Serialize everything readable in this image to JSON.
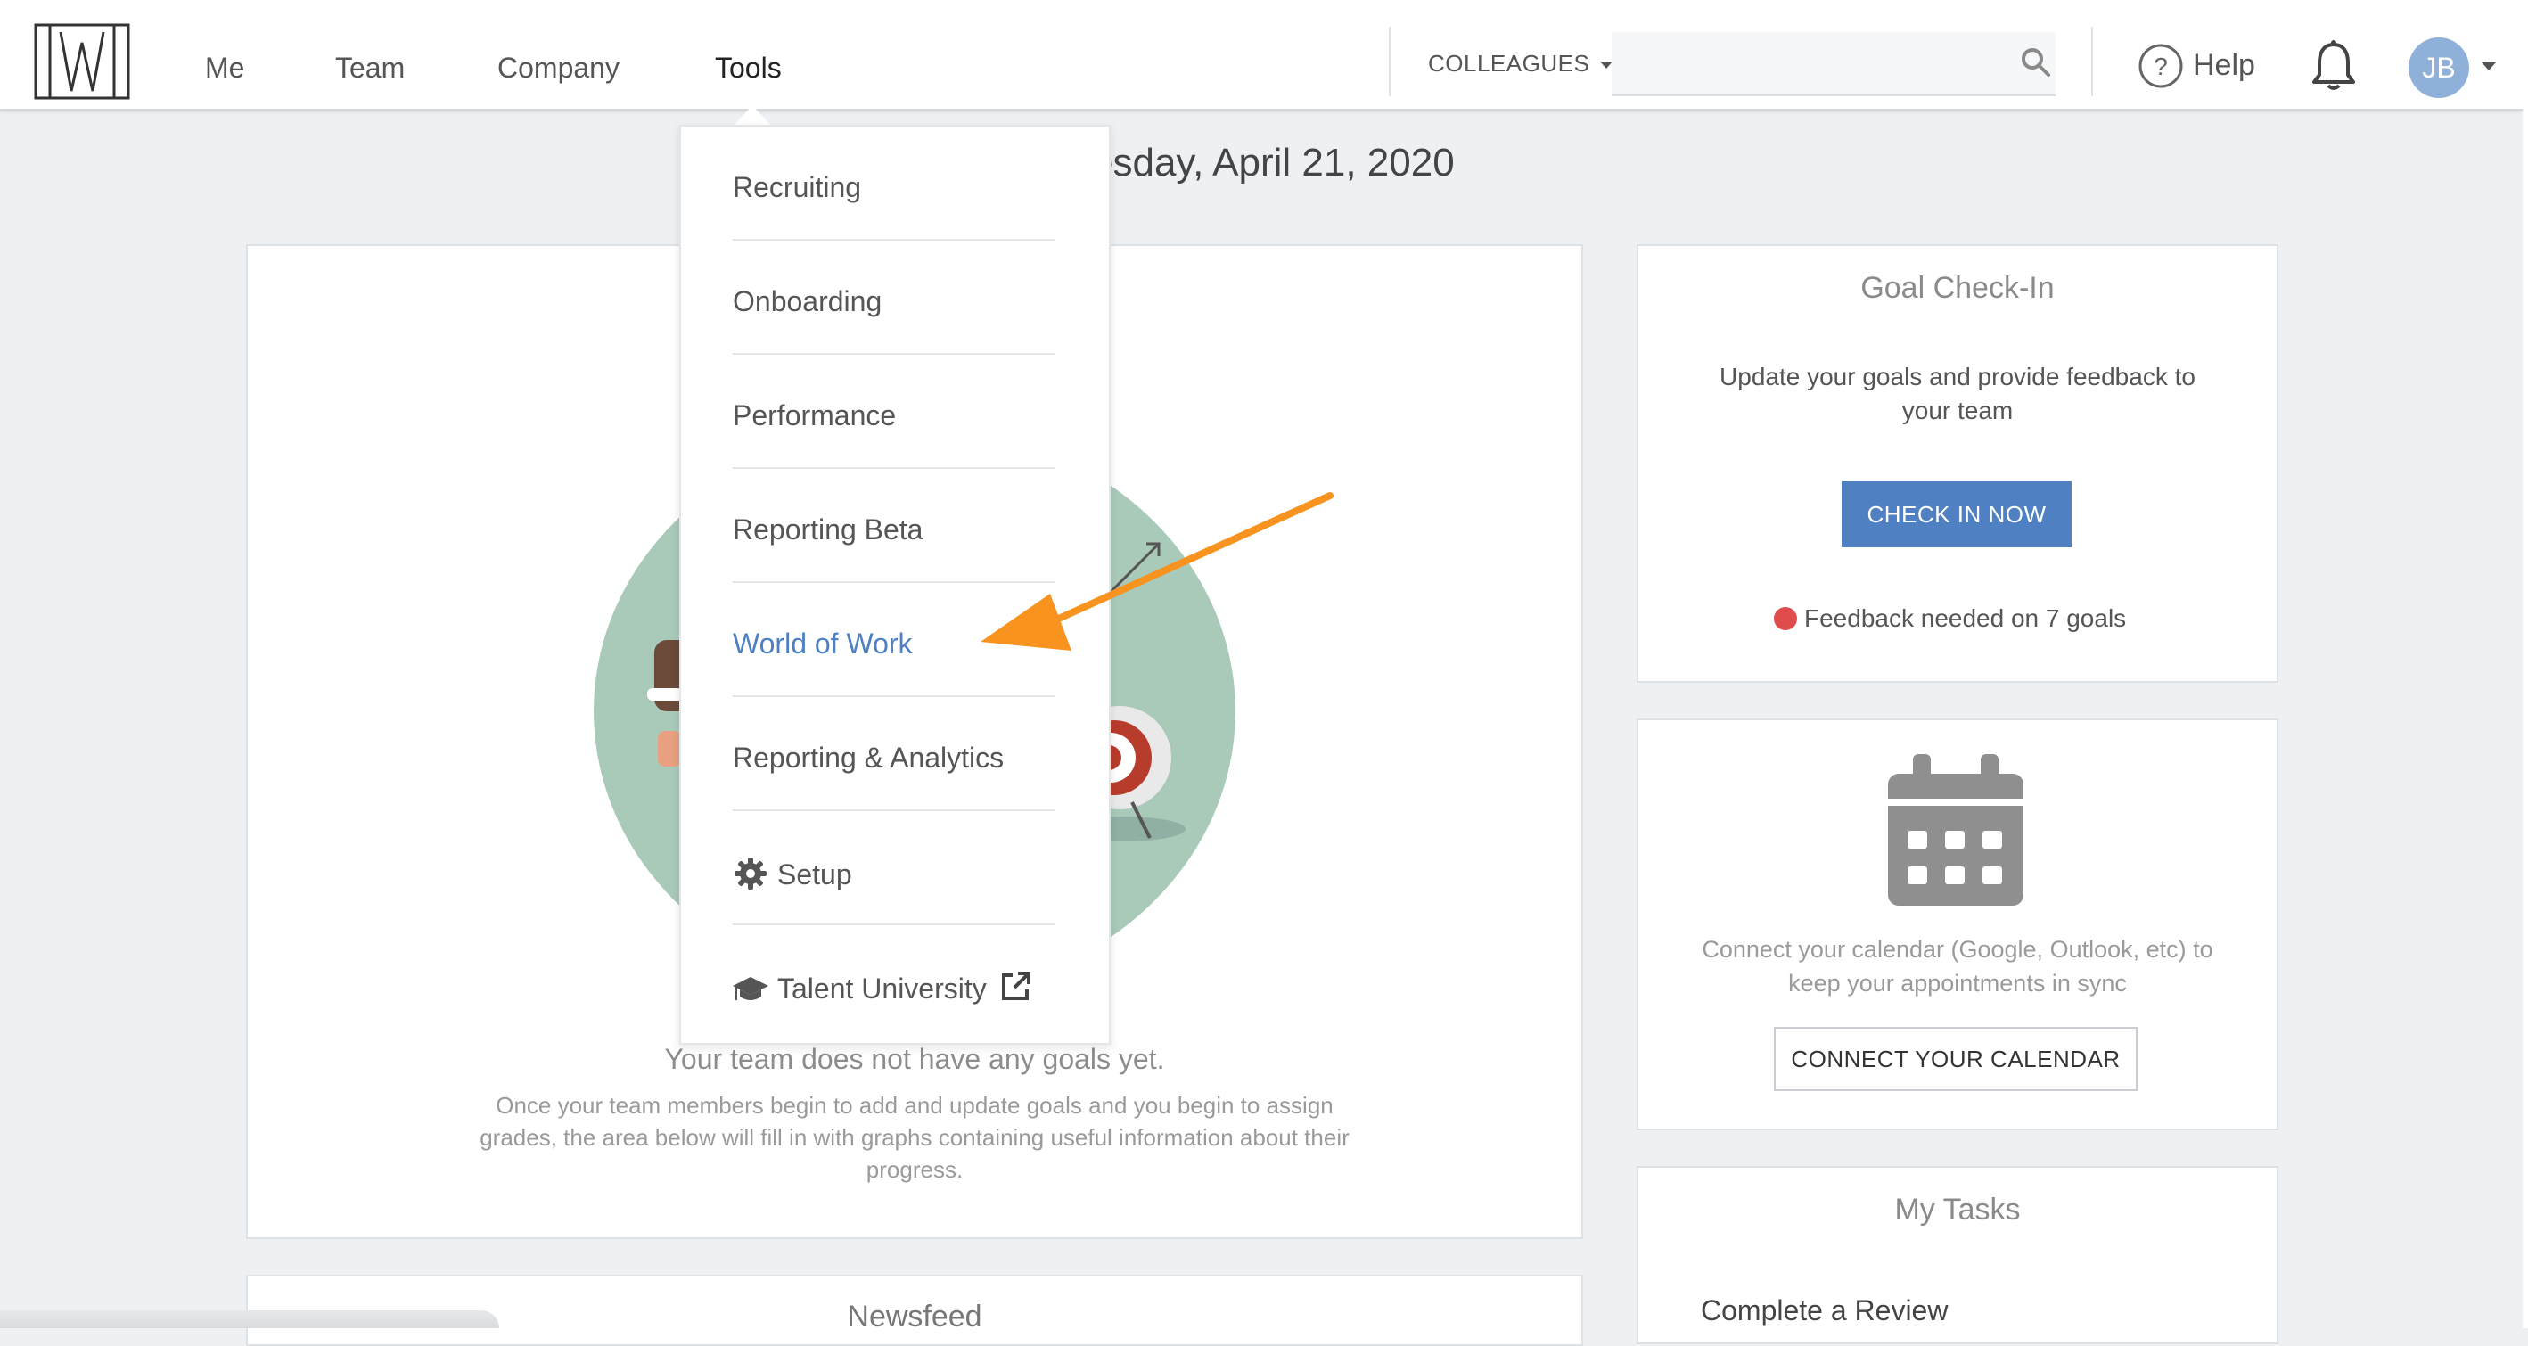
{
  "nav": {
    "items": [
      {
        "label": "Me"
      },
      {
        "label": "Team"
      },
      {
        "label": "Company"
      },
      {
        "label": "Tools"
      }
    ],
    "colleagues_label": "COLLEAGUES",
    "search_placeholder": "",
    "help_label": "Help",
    "avatar_initials": "JB"
  },
  "page": {
    "date_title": "esday, April 21, 2020"
  },
  "tools_menu": {
    "items": [
      {
        "label": "Recruiting"
      },
      {
        "label": "Onboarding"
      },
      {
        "label": "Performance"
      },
      {
        "label": "Reporting Beta"
      },
      {
        "label": "World of Work"
      },
      {
        "label": "Reporting & Analytics"
      },
      {
        "label": "Setup",
        "icon": "gear-icon"
      },
      {
        "label": "Talent University",
        "icon": "graduation-cap-icon",
        "trailing_icon": "external-link-icon"
      }
    ]
  },
  "goals_panel": {
    "empty_title": "Your team does not have any goals yet.",
    "empty_description": "Once your team members begin to add and update goals and you begin to assign grades, the area below will fill in with graphs containing useful information about their progress."
  },
  "newsfeed": {
    "title": "Newsfeed"
  },
  "goal_checkin": {
    "title": "Goal Check-In",
    "description": "Update your goals and provide feedback to your team",
    "button_label": "CHECK IN NOW",
    "feedback_text": "Feedback needed on 7 goals"
  },
  "calendar": {
    "description": "Connect your calendar (Google, Outlook, etc) to keep your appointments in sync",
    "button_label": "CONNECT YOUR CALENDAR"
  },
  "tasks": {
    "title": "My Tasks",
    "items": [
      {
        "label": "Complete a Review"
      }
    ]
  },
  "colors": {
    "accent": "#4f80c2",
    "annotation_arrow": "#f7931e",
    "alert": "#e04b4b",
    "illustration_green": "#a9c9b9"
  }
}
